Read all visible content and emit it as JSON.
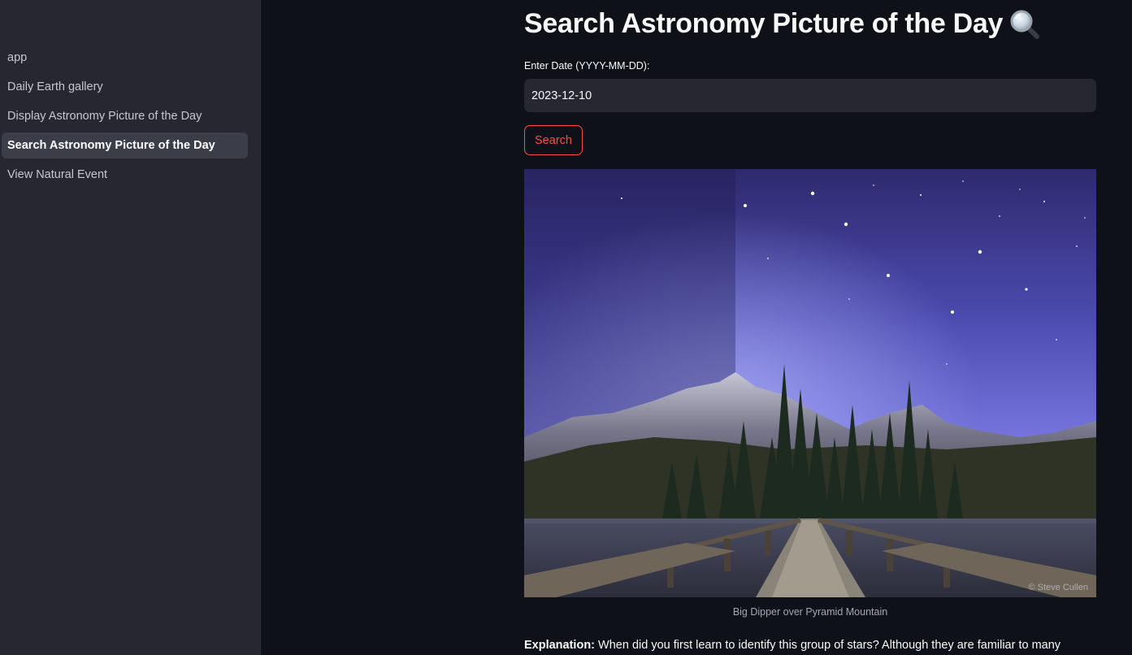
{
  "sidebar": {
    "items": [
      {
        "label": "app",
        "active": false
      },
      {
        "label": "Daily Earth gallery",
        "active": false
      },
      {
        "label": "Display Astronomy Picture of the Day",
        "active": false
      },
      {
        "label": "Search Astronomy Picture of the Day",
        "active": true
      },
      {
        "label": "View Natural Event",
        "active": false
      }
    ]
  },
  "main": {
    "title": "Search Astronomy Picture of the Day",
    "title_icon": "magnifying-glass-icon",
    "date_label": "Enter Date (YYYY-MM-DD):",
    "date_value": "2023-12-10",
    "search_label": "Search",
    "image_credit": "© Steve Cullen",
    "caption": "Big Dipper over Pyramid Mountain",
    "explanation_label": "Explanation:",
    "explanation_text": "When did you first learn to identify this group of stars? Although they are familiar to many"
  },
  "colors": {
    "accent": "#ff4b4b",
    "background": "#0e1117",
    "sidebar": "#262730"
  }
}
